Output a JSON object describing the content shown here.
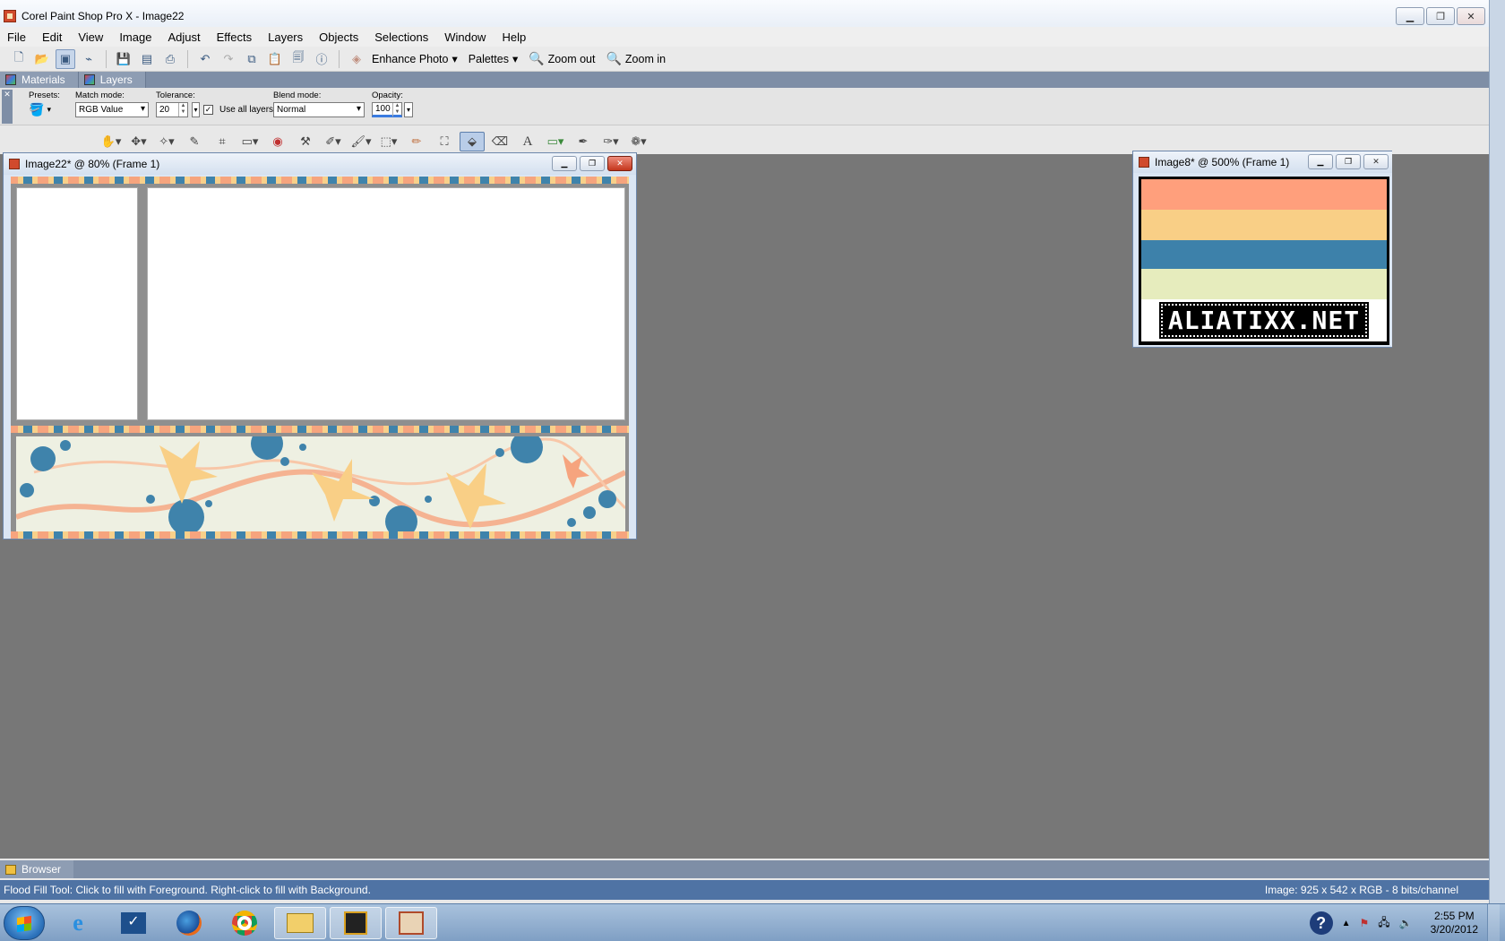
{
  "app": {
    "title": "Corel Paint Shop Pro X - Image22"
  },
  "menu": [
    "File",
    "Edit",
    "View",
    "Image",
    "Adjust",
    "Effects",
    "Layers",
    "Objects",
    "Selections",
    "Window",
    "Help"
  ],
  "toolbar": {
    "enhance_photo": "Enhance Photo",
    "palettes": "Palettes",
    "zoom_out": "Zoom out",
    "zoom_in": "Zoom in"
  },
  "palette_tabs": {
    "materials": "Materials",
    "layers": "Layers"
  },
  "tool_options": {
    "presets_label": "Presets:",
    "match_mode_label": "Match mode:",
    "match_mode_value": "RGB Value",
    "tolerance_label": "Tolerance:",
    "tolerance_value": "20",
    "use_all_layers_label": "Use all layers",
    "use_all_layers_checked": true,
    "blend_mode_label": "Blend mode:",
    "blend_mode_value": "Normal",
    "opacity_label": "Opacity:",
    "opacity_value": "100"
  },
  "doc1": {
    "title": "Image22* @  80% (Frame 1)"
  },
  "doc2": {
    "title": "Image8* @ 500% (Frame 1)",
    "logo_text": "ALIATIXX.NET"
  },
  "browser_tab": "Browser",
  "status": {
    "left": "Flood Fill Tool: Click to fill with Foreground. Right-click to fill with Background.",
    "right": "Image:  925 x 542 x RGB - 8 bits/channel"
  },
  "clock": {
    "time": "2:55 PM",
    "date": "3/20/2012"
  },
  "colors": {
    "peach": "#ff9f7c",
    "yellow": "#f9cf86",
    "blue": "#3d81aa",
    "lime": "#e6ecbd"
  }
}
